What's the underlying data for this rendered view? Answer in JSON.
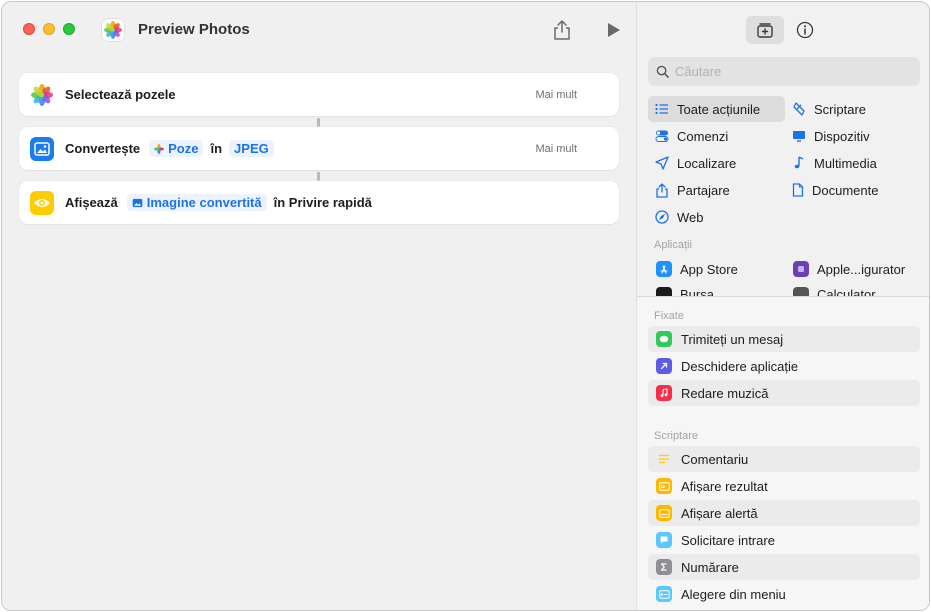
{
  "window": {
    "title": "Preview Photos"
  },
  "workflow": {
    "steps": [
      {
        "label": "Selectează pozele",
        "more": "Mai mult"
      },
      {
        "label": "Convertește",
        "token1": "Poze",
        "connector": "în",
        "token2": "JPEG",
        "more": "Mai mult"
      },
      {
        "label": "Afișează",
        "token1": "Imagine convertită",
        "tail": "în Privire rapidă"
      }
    ]
  },
  "sidebar": {
    "search_placeholder": "Căutare",
    "categories": [
      {
        "label": "Toate acțiunile",
        "icon": "list-icon",
        "selected": true
      },
      {
        "label": "Scriptare",
        "icon": "scripting-icon"
      },
      {
        "label": "Comenzi",
        "icon": "toggle-icon"
      },
      {
        "label": "Dispozitiv",
        "icon": "display-icon"
      },
      {
        "label": "Localizare",
        "icon": "location-icon"
      },
      {
        "label": "Multimedia",
        "icon": "music-note-icon"
      },
      {
        "label": "Partajare",
        "icon": "share-icon"
      },
      {
        "label": "Documente",
        "icon": "document-icon"
      },
      {
        "label": "Web",
        "icon": "compass-icon"
      }
    ],
    "apps_label": "Aplicații",
    "apps": [
      {
        "label": "App Store",
        "color": "#1e90ff"
      },
      {
        "label": "Apple...igurator",
        "color": "#6b3fb5"
      },
      {
        "label": "Bursa",
        "color": "#1c1c1e"
      },
      {
        "label": "Calculator",
        "color": "#555555"
      }
    ],
    "pinned_label": "Fixate",
    "pinned": [
      {
        "label": "Trimiteți un mesaj",
        "color": "#34c759"
      },
      {
        "label": "Deschidere aplicație",
        "color": "#5e5ce6"
      },
      {
        "label": "Redare muzică",
        "color": "#fa2d48"
      }
    ],
    "scripting_label": "Scriptare",
    "scripting": [
      {
        "label": "Comentariu",
        "color": "#ffd60a"
      },
      {
        "label": "Afișare rezultat",
        "color": "#ffb800"
      },
      {
        "label": "Afișare alertă",
        "color": "#ffb800"
      },
      {
        "label": "Solicitare intrare",
        "color": "#5ac8fa"
      },
      {
        "label": "Numărare",
        "color": "#8e8e93"
      },
      {
        "label": "Alegere din meniu",
        "color": "#5ac8fa"
      }
    ]
  }
}
